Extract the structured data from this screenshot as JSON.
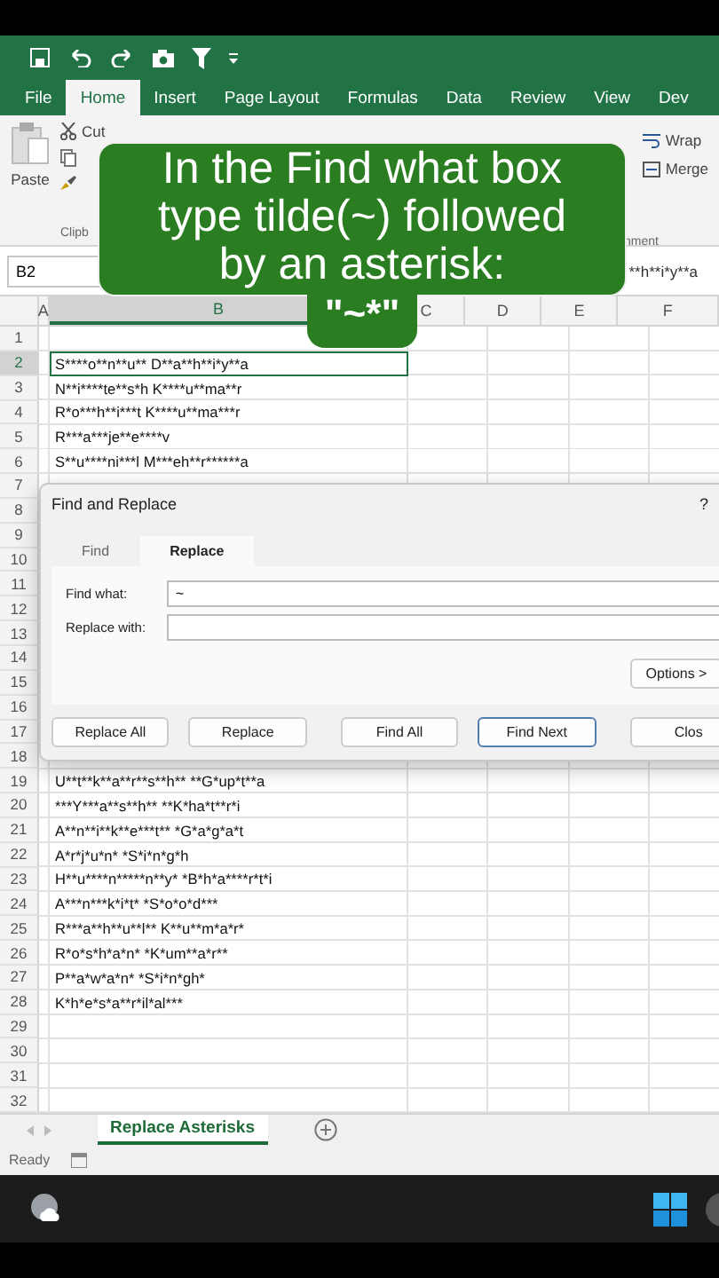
{
  "ribbon_tabs": [
    {
      "label": "File",
      "selected": false
    },
    {
      "label": "Home",
      "selected": true
    },
    {
      "label": "Insert",
      "selected": false
    },
    {
      "label": "Page Layout",
      "selected": false
    },
    {
      "label": "Formulas",
      "selected": false
    },
    {
      "label": "Data",
      "selected": false
    },
    {
      "label": "Review",
      "selected": false
    },
    {
      "label": "View",
      "selected": false
    },
    {
      "label": "Dev",
      "selected": false
    }
  ],
  "ribbon": {
    "paste": "Paste",
    "cut": "Cut",
    "clipboard_group": "Clipb",
    "wrap": "Wrap",
    "merge": "Merge",
    "alignment_group": "nment"
  },
  "formula_bar": {
    "name_box": "B2",
    "content": "**h**i*y**a"
  },
  "caption": {
    "text": "In the Find what box type tilde(~) followed by an asterisk:",
    "example": "\"~*\""
  },
  "grid": {
    "columns": [
      {
        "label": "A",
        "selected": false
      },
      {
        "label": "B",
        "selected": true
      },
      {
        "label": "C",
        "selected": false
      },
      {
        "label": "D",
        "selected": false
      },
      {
        "label": "E",
        "selected": false
      },
      {
        "label": "F",
        "selected": false
      }
    ],
    "rows": [
      {
        "number": "1",
        "selected": false
      },
      {
        "number": "2",
        "selected": true,
        "text": "S****o**n**u** D**a**h**i*y**a"
      },
      {
        "number": "3",
        "selected": false,
        "text": "N**i****te**s*h K****u**ma**r"
      },
      {
        "number": "4",
        "selected": false,
        "text": "R*o***h**i***t K****u**ma***r"
      },
      {
        "number": "5",
        "selected": false,
        "text": "R***a***je**e****v"
      },
      {
        "number": "6",
        "selected": false,
        "text": "S**u****ni***l M***eh**r******a"
      },
      {
        "number": "7",
        "selected": false
      },
      {
        "number": "8",
        "selected": false
      },
      {
        "number": "9",
        "selected": false
      },
      {
        "number": "10",
        "selected": false
      },
      {
        "number": "11",
        "selected": false
      },
      {
        "number": "12",
        "selected": false
      },
      {
        "number": "13",
        "selected": false
      },
      {
        "number": "14",
        "selected": false
      },
      {
        "number": "15",
        "selected": false
      },
      {
        "number": "16",
        "selected": false
      },
      {
        "number": "17",
        "selected": false
      },
      {
        "number": "18",
        "selected": false
      },
      {
        "number": "19",
        "selected": false,
        "text": "U**t**k**a**r**s**h** **G*up*t**a"
      },
      {
        "number": "20",
        "selected": false,
        "text": "***Y***a**s**h** **K*ha*t**r*i"
      },
      {
        "number": "21",
        "selected": false,
        "text": "A**n**i**k**e***t** *G*a*g*a*t"
      },
      {
        "number": "22",
        "selected": false,
        "text": "A*r*j*u*n* *S*i*n*g*h"
      },
      {
        "number": "23",
        "selected": false,
        "text": "H**u****n*****n**y* *B*h*a****r*t*i"
      },
      {
        "number": "24",
        "selected": false,
        "text": "A***n***k*i*t* *S*o*o*d***"
      },
      {
        "number": "25",
        "selected": false,
        "text": "R***a**h**u**l** K**u**m*a*r*"
      },
      {
        "number": "26",
        "selected": false,
        "text": "R*o*s*h*a*n* *K*um**a*r**"
      },
      {
        "number": "27",
        "selected": false,
        "text": "P**a*w*a*n* *S*i*n*gh*"
      },
      {
        "number": "28",
        "selected": false,
        "text": "K*h*e*s*a**r*il*al***"
      },
      {
        "number": "29",
        "selected": false
      },
      {
        "number": "30",
        "selected": false
      },
      {
        "number": "31",
        "selected": false
      },
      {
        "number": "32",
        "selected": false
      }
    ]
  },
  "dialog": {
    "title": "Find and Replace",
    "help": "?",
    "tabs": [
      {
        "label": "Find",
        "selected": false
      },
      {
        "label": "Replace",
        "selected": true
      }
    ],
    "fields": [
      {
        "label": "Find what:",
        "value": "~"
      },
      {
        "label": "Replace with:"
      }
    ],
    "options_button": "Options >",
    "buttons": [
      {
        "label": "Replace All",
        "focused": false
      },
      {
        "label": "Replace",
        "focused": false
      },
      {
        "label": "Find All",
        "focused": false
      },
      {
        "label": "Find Next",
        "focused": true
      },
      {
        "label": "Clos",
        "focused": false
      }
    ]
  },
  "sheet_tabs": [
    {
      "label": "Replace Asterisks",
      "selected": true
    }
  ],
  "status_bar": {
    "text": "Ready"
  }
}
